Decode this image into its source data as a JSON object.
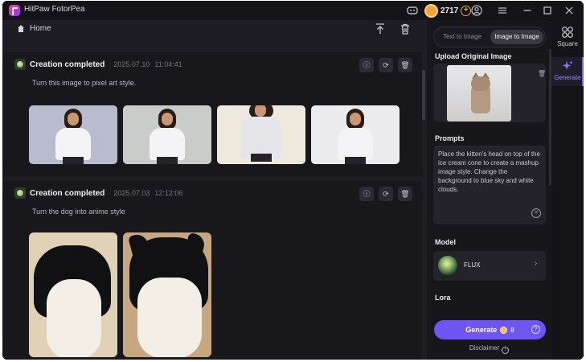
{
  "app": {
    "title": "HitPaw FotorPea"
  },
  "titlebar": {
    "coins": "2717",
    "discord_icon": "discord-icon",
    "add_coins_icon": "plus-circle-icon",
    "user_icon": "user-icon",
    "menu_icon": "menu-icon",
    "window_controls": [
      "minimize-icon",
      "maximize-icon",
      "close-icon"
    ]
  },
  "main": {
    "home_label": "Home",
    "creations": [
      {
        "title": "Creation completed",
        "date": "2025.07.10",
        "time": "11:04:41",
        "prompt": "Turn this image to pixel art style."
      },
      {
        "title": "Creation completed",
        "date": "2025.07.03",
        "time": "12:12:06",
        "prompt": "Turn the dog into anime style"
      }
    ]
  },
  "side": {
    "tabs": [
      "Text to Image",
      "Image to Image"
    ],
    "active_tab": "Image to Image",
    "upload_label": "Upload Original Image",
    "prompts_label": "Prompts",
    "prompt_value": "Place the kitten's head on top of the ice cream cone to create a mashup image style. Change the background to blue sky and white clouds.",
    "model_label": "Model",
    "model_name": "FLUX",
    "lora_label": "Lora",
    "generate_label": "Generate",
    "generate_cost": "8",
    "disclaimer": "Disclaimer"
  },
  "rail": {
    "items": [
      {
        "label": "Square",
        "icon": "grid-icon"
      },
      {
        "label": "Generate",
        "icon": "sparkle-icon"
      }
    ],
    "active": "Generate"
  },
  "colors": {
    "accent": "#6f56f2",
    "background": "#141318",
    "panel": "#1d1c22",
    "coin": "#f0a53a"
  }
}
